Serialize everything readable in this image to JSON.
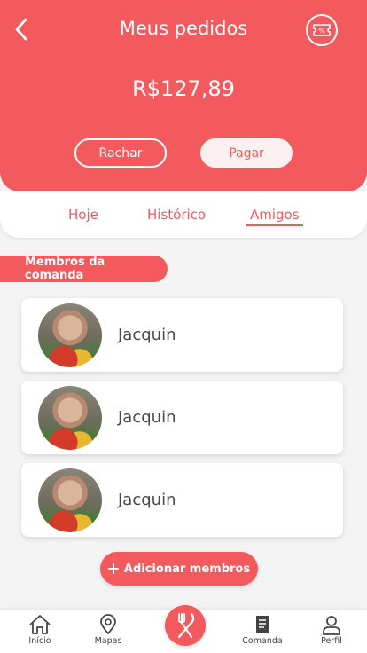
{
  "header": {
    "title": "Meus pedidos",
    "amount": "R$127,89",
    "split_label": "Rachar",
    "pay_label": "Pagar",
    "coupon_icon_text": "%"
  },
  "tabs": [
    {
      "label": "Hoje"
    },
    {
      "label": "Histórico"
    },
    {
      "label": "Amigos",
      "active": true
    }
  ],
  "section": {
    "title": "Membros da comanda"
  },
  "members": [
    {
      "name": "Jacquin"
    },
    {
      "name": "Jacquin"
    },
    {
      "name": "Jacquin"
    }
  ],
  "add_members_label": "Adicionar membros",
  "bottom_nav": {
    "items": [
      {
        "label": "Início",
        "icon": "home-icon"
      },
      {
        "label": "Mapas",
        "icon": "map-pin-icon"
      },
      {
        "label": "Comanda",
        "icon": "receipt-icon"
      },
      {
        "label": "Perfil",
        "icon": "user-icon"
      }
    ],
    "center_icon": "fork-knife-icon"
  },
  "colors": {
    "accent": "#f25a5e",
    "background": "#f3f3f3"
  }
}
